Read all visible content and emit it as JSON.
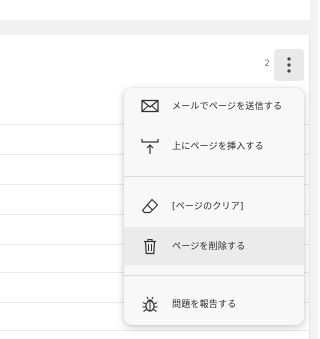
{
  "page": {
    "page_number": "2"
  },
  "toolbar": {
    "more_icon": "vertical-ellipsis-icon"
  },
  "menu": {
    "items": [
      {
        "label": "メールでページを送信する",
        "icon": "envelope-icon"
      },
      {
        "label": "上にページを挿入する",
        "icon": "insert-above-icon"
      },
      {
        "label": "[ページのクリア]",
        "icon": "eraser-icon"
      },
      {
        "label": "ページを削除する",
        "icon": "trash-icon"
      },
      {
        "label": "問題を報告する",
        "icon": "bug-icon"
      }
    ]
  },
  "colors": {
    "menu_bg": "#f8f8f8",
    "hover_bg": "#ebebeb",
    "button_bg": "#e9e9e9"
  }
}
